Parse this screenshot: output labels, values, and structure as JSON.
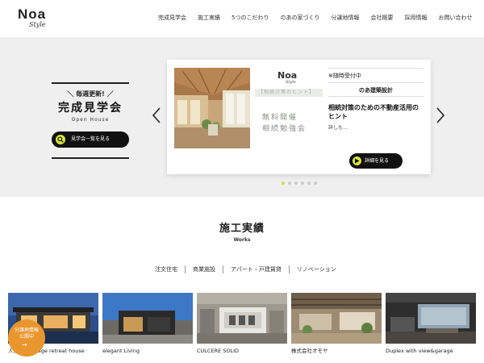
{
  "header": {
    "logo_main": "Noa",
    "logo_sub": "Style",
    "nav": [
      "完成見学会",
      "施工実績",
      "5つのこだわり",
      "のあの家づくり",
      "分譲地情報",
      "会社概要",
      "採用情報",
      "お問い合わせ"
    ]
  },
  "hero": {
    "tagline": "＼ 毎週更新! ／",
    "title": "完成見学会",
    "subtitle": "Open House",
    "button_label": "見学会一覧を見る",
    "slide": {
      "flyer_logo": "Noa",
      "flyer_logo_sub": "Style",
      "flyer_band": "【相続対策のヒント】",
      "flyer_line1": "無料開催",
      "flyer_line2": "相続勉強会",
      "status": "※随時受付中",
      "company": "のあ建築設計",
      "title": "相続対策のための不動産活用のヒント",
      "more": "詳しも…",
      "button_label": "詳細を見る"
    },
    "dots_total": 6,
    "dots_active": 0
  },
  "works": {
    "title": "施工実績",
    "subtitle": "Works",
    "filters": [
      "注文住宅",
      "商業施設",
      "アパート・戸建賃貸",
      "リノベーション"
    ],
    "items": [
      {
        "caption": "人が集うgarage retreat house"
      },
      {
        "caption": "elegant Living"
      },
      {
        "caption": "CULCERE SOLID"
      },
      {
        "caption": "株式会社オモヤ"
      },
      {
        "caption": "Duplex with view&garage"
      }
    ]
  },
  "badge": {
    "line1": "分譲地情報",
    "line2": "公開中",
    "arrow": "→"
  },
  "colors": {
    "accent": "#d7e63a",
    "badge": "#e9962f",
    "hero_bg": "#efefef"
  }
}
